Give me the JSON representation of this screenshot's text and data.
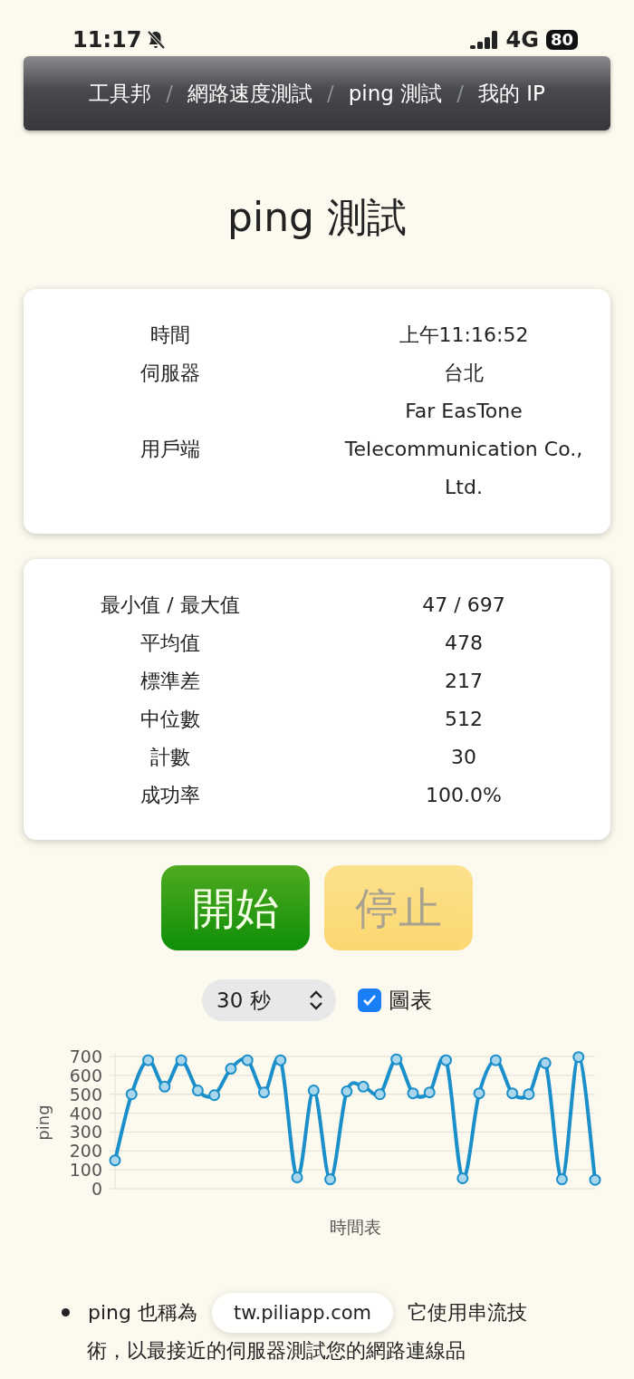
{
  "status_bar": {
    "time": "11:17",
    "network": "4G",
    "battery": "80",
    "silent": true
  },
  "breadcrumb": [
    {
      "kind": "link",
      "label": "工具邦"
    },
    {
      "kind": "separator",
      "label": "/"
    },
    {
      "kind": "link",
      "label": "網路速度測試"
    },
    {
      "kind": "separator",
      "label": "/"
    },
    {
      "kind": "link",
      "label": "ping 測試"
    },
    {
      "kind": "separator",
      "label": "/"
    },
    {
      "kind": "link",
      "label": "我的 IP"
    }
  ],
  "title": "ping 測試",
  "info": [
    {
      "label": "時間",
      "value": "上午11:16:52"
    },
    {
      "label": "伺服器",
      "value": "台北"
    },
    {
      "label": "用戶端",
      "value": "Far EasTone Telecommunication Co., Ltd."
    }
  ],
  "stats": [
    {
      "label": "最小值 / 最大值",
      "value": "47 / 697"
    },
    {
      "label": "平均值",
      "value": "478"
    },
    {
      "label": "標準差",
      "value": "217"
    },
    {
      "label": "中位數",
      "value": "512"
    },
    {
      "label": "計數",
      "value": "30"
    },
    {
      "label": "成功率",
      "value": "100.0%"
    }
  ],
  "buttons": [
    {
      "label": "開始",
      "kind": "start",
      "disabled": false
    },
    {
      "label": "停止",
      "kind": "stop",
      "disabled": true
    }
  ],
  "duration": {
    "value": "30 秒"
  },
  "show_chart": {
    "label": "圖表",
    "checked": true
  },
  "chart": {
    "chart_data": {
      "type": "line",
      "xlabel": "時間表",
      "ylabel": "ping",
      "ylim": [
        0,
        700
      ],
      "yticks": [
        0,
        100,
        200,
        300,
        400,
        500,
        600,
        700
      ],
      "grid": true,
      "marker": true,
      "series": [
        {
          "color": "#1a8fc9",
          "values": [
            150,
            500,
            680,
            540,
            680,
            520,
            495,
            635,
            680,
            510,
            680,
            60,
            520,
            50,
            515,
            540,
            500,
            685,
            505,
            510,
            680,
            55,
            505,
            680,
            505,
            500,
            665,
            50,
            697,
            47
          ]
        }
      ]
    }
  },
  "bullet": {
    "before": "ping 也稱為",
    "after": "它使用串流技",
    "line2": "術，以最接近的伺服器測試您的網路連線品"
  },
  "address_bar": {
    "url": "tw.piliapp.com"
  }
}
